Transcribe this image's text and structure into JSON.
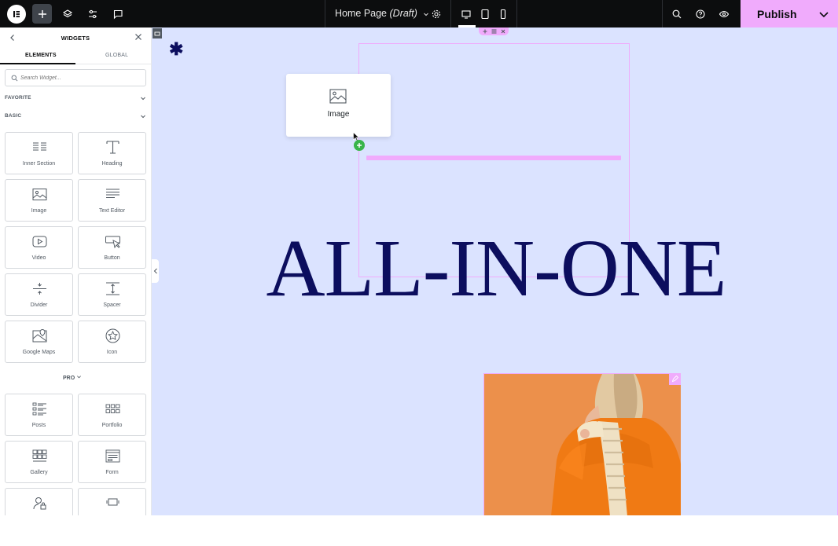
{
  "topbar": {
    "page_title": "Home Page",
    "page_status": "(Draft)",
    "publish_label": "Publish",
    "accent_color": "#f0abfc",
    "icons": [
      "elementor-logo-icon",
      "add-element-icon",
      "structure-layers-icon",
      "site-settings-icon",
      "notes-comment-icon",
      "page-settings-gear-icon",
      "desktop-icon",
      "tablet-icon",
      "mobile-icon",
      "finder-search-icon",
      "help-icon",
      "preview-eye-icon",
      "publish-options-chevron-icon"
    ]
  },
  "sidebar": {
    "title": "WIDGETS",
    "tabs": [
      {
        "label": "ELEMENTS",
        "active": true
      },
      {
        "label": "GLOBAL",
        "active": false
      }
    ],
    "search_placeholder": "Search Widget...",
    "sections": {
      "favorite": "FAVORITE",
      "basic": "BASIC",
      "pro": "PRO"
    },
    "basic_widgets": [
      {
        "label": "Inner Section",
        "icon": "inner-section-icon"
      },
      {
        "label": "Heading",
        "icon": "heading-icon"
      },
      {
        "label": "Image",
        "icon": "image-icon"
      },
      {
        "label": "Text Editor",
        "icon": "text-editor-icon"
      },
      {
        "label": "Video",
        "icon": "video-icon"
      },
      {
        "label": "Button",
        "icon": "button-icon"
      },
      {
        "label": "Divider",
        "icon": "divider-icon"
      },
      {
        "label": "Spacer",
        "icon": "spacer-icon"
      },
      {
        "label": "Google Maps",
        "icon": "google-maps-icon"
      },
      {
        "label": "Icon",
        "icon": "star-icon"
      }
    ],
    "pro_widgets": [
      {
        "label": "Posts",
        "icon": "posts-icon"
      },
      {
        "label": "Portfolio",
        "icon": "portfolio-icon"
      },
      {
        "label": "Gallery",
        "icon": "gallery-icon"
      },
      {
        "label": "Form",
        "icon": "form-icon"
      },
      {
        "label": "",
        "icon": "login-icon"
      },
      {
        "label": "",
        "icon": "slides-icon"
      }
    ]
  },
  "canvas": {
    "background": "#dbe3ff",
    "headline": "ALL-IN-ONE",
    "headline_color": "#0c0e5e",
    "drag_preview_label": "Image",
    "drop_indicator_color": "#f0abfc",
    "add_badge_color": "#39b54a"
  }
}
